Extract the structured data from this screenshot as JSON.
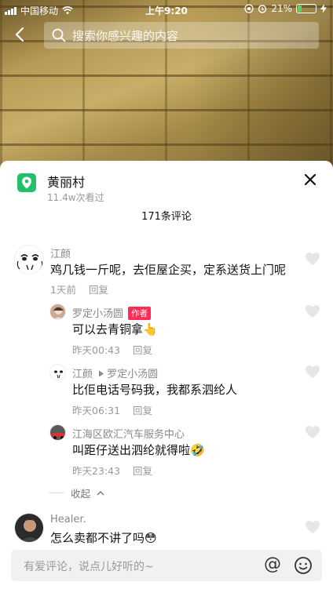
{
  "status_bar": {
    "carrier": "中国移动",
    "time": "上午9:20",
    "battery": "21%",
    "battery_level": 0.21
  },
  "search": {
    "placeholder": "搜索你感兴趣的内容"
  },
  "location": {
    "name": "黄丽村",
    "views": "11.4w次看过"
  },
  "comment_count": "171条评论",
  "comments": [
    {
      "user": "江颜",
      "text": "鸡几钱一斤呢，去佢屋企买，定系送货上门呢",
      "time": "1天前",
      "reply": "回复",
      "replies": [
        {
          "user": "罗定小汤圆",
          "tag": "作者",
          "text": "可以去青铜拿",
          "emoji": "👆",
          "time": "昨天00:43",
          "reply": "回复"
        },
        {
          "user": "江颜",
          "reply_to": "罗定小汤圆",
          "text": "比佢电话号码我，我都系泗纶人",
          "time": "昨天06:31",
          "reply": "回复"
        },
        {
          "user": "江海区欧汇汽车服务中心",
          "text": "叫距仔送出泗纶就得啦",
          "emoji": "🤣",
          "time": "昨天23:43",
          "reply": "回复"
        }
      ],
      "collapse": "收起"
    },
    {
      "user": "Healer.",
      "text": "怎么卖都不讲了吗",
      "emoji": "😳"
    }
  ],
  "input": {
    "placeholder": "有爱评论，说点儿好听的~"
  },
  "colors": {
    "accent": "#fe2c55",
    "location_green": "#22c06a"
  }
}
